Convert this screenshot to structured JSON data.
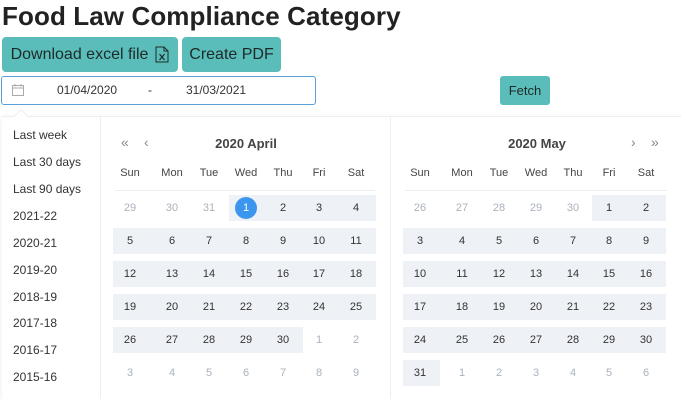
{
  "header": {
    "title": "Food Law Compliance Category"
  },
  "toolbar": {
    "download_excel_label": "Download excel file",
    "create_pdf_label": "Create PDF",
    "fetch_label": "Fetch"
  },
  "range": {
    "start": "01/04/2020",
    "separator": "-",
    "end": "31/03/2021"
  },
  "presets": [
    "Last week",
    "Last 30 days",
    "Last 90 days",
    "2021-22",
    "2020-21",
    "2019-20",
    "2018-19",
    "2017-18",
    "2016-17",
    "2015-16"
  ],
  "weekdays": [
    "Sun",
    "Mon",
    "Tue",
    "Wed",
    "Thu",
    "Fri",
    "Sat"
  ],
  "calendars": [
    {
      "title": "2020 April",
      "weeks": [
        [
          "29",
          "30",
          "31",
          "1",
          "2",
          "3",
          "4"
        ],
        [
          "5",
          "6",
          "7",
          "8",
          "9",
          "10",
          "11"
        ],
        [
          "12",
          "13",
          "14",
          "15",
          "16",
          "17",
          "18"
        ],
        [
          "19",
          "20",
          "21",
          "22",
          "23",
          "24",
          "25"
        ],
        [
          "26",
          "27",
          "28",
          "29",
          "30",
          "1",
          "2"
        ],
        [
          "3",
          "4",
          "5",
          "6",
          "7",
          "8",
          "9"
        ]
      ],
      "in_range": [
        [
          false,
          false,
          false,
          true,
          true,
          true,
          true
        ],
        [
          true,
          true,
          true,
          true,
          true,
          true,
          true
        ],
        [
          true,
          true,
          true,
          true,
          true,
          true,
          true
        ],
        [
          true,
          true,
          true,
          true,
          true,
          true,
          true
        ],
        [
          true,
          true,
          true,
          true,
          true,
          false,
          false
        ],
        [
          false,
          false,
          false,
          false,
          false,
          false,
          false
        ]
      ],
      "muted": [
        [
          true,
          true,
          true,
          false,
          false,
          false,
          false
        ],
        [
          false,
          false,
          false,
          false,
          false,
          false,
          false
        ],
        [
          false,
          false,
          false,
          false,
          false,
          false,
          false
        ],
        [
          false,
          false,
          false,
          false,
          false,
          false,
          false
        ],
        [
          false,
          false,
          false,
          false,
          false,
          true,
          true
        ],
        [
          true,
          true,
          true,
          true,
          true,
          true,
          true
        ]
      ],
      "selected": {
        "week": 0,
        "day": 3
      }
    },
    {
      "title": "2020 May",
      "weeks": [
        [
          "26",
          "27",
          "28",
          "29",
          "30",
          "1",
          "2"
        ],
        [
          "3",
          "4",
          "5",
          "6",
          "7",
          "8",
          "9"
        ],
        [
          "10",
          "11",
          "12",
          "13",
          "14",
          "15",
          "16"
        ],
        [
          "17",
          "18",
          "19",
          "20",
          "21",
          "22",
          "23"
        ],
        [
          "24",
          "25",
          "26",
          "27",
          "28",
          "29",
          "30"
        ],
        [
          "31",
          "1",
          "2",
          "3",
          "4",
          "5",
          "6"
        ]
      ],
      "in_range": [
        [
          false,
          false,
          false,
          false,
          false,
          true,
          true
        ],
        [
          true,
          true,
          true,
          true,
          true,
          true,
          true
        ],
        [
          true,
          true,
          true,
          true,
          true,
          true,
          true
        ],
        [
          true,
          true,
          true,
          true,
          true,
          true,
          true
        ],
        [
          true,
          true,
          true,
          true,
          true,
          true,
          true
        ],
        [
          true,
          false,
          false,
          false,
          false,
          false,
          false
        ]
      ],
      "muted": [
        [
          true,
          true,
          true,
          true,
          true,
          false,
          false
        ],
        [
          false,
          false,
          false,
          false,
          false,
          false,
          false
        ],
        [
          false,
          false,
          false,
          false,
          false,
          false,
          false
        ],
        [
          false,
          false,
          false,
          false,
          false,
          false,
          false
        ],
        [
          false,
          false,
          false,
          false,
          false,
          false,
          false
        ],
        [
          false,
          true,
          true,
          true,
          true,
          true,
          true
        ]
      ],
      "selected": null
    }
  ],
  "colors": {
    "accent": "#5bbdb9",
    "selected_day": "#3c96ef",
    "range_bg": "#eef1f6",
    "input_border": "#5a9fd8"
  }
}
